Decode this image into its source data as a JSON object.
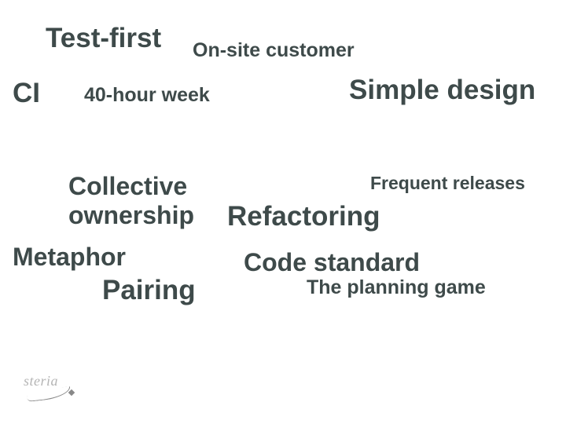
{
  "terms": {
    "test_first": "Test-first",
    "on_site_customer": "On-site customer",
    "ci": "CI",
    "forty_hour_week": "40-hour week",
    "simple_design": "Simple design",
    "collective_ownership_l1": "Collective",
    "collective_ownership_l2": "ownership",
    "frequent_releases": "Frequent releases",
    "refactoring": "Refactoring",
    "metaphor": "Metaphor",
    "code_standard": "Code standard",
    "pairing": "Pairing",
    "planning_game": "The planning game"
  },
  "logo": {
    "text": "steria"
  }
}
